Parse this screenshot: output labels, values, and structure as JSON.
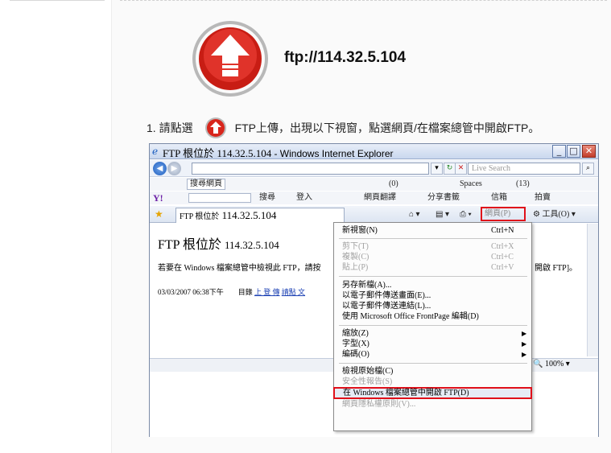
{
  "ftp_url": "ftp://114.32.5.104",
  "instruction": {
    "prefix": "1. 請點選",
    "suffix": "FTP上傳，出現以下視窗，點選網頁/在檔案總管中開啟FTP。"
  },
  "colors": {
    "accent_red": "#d8261c",
    "highlight_border": "#e0101a",
    "ie_blue": "#1f5fbf"
  },
  "icons": {
    "upload": "upload-arrow-icon",
    "ie": "ie-logo-icon",
    "home": "home-icon",
    "star": "favorites-star-icon"
  },
  "ie_window": {
    "title_ie": "FTP 根位於",
    "title_addr": "114.32.5.104",
    "title_app": "- Windows Internet Explorer",
    "search_placeholder": "Live Search",
    "toolbar1": {
      "search_label": "搜尋網頁",
      "inbox": "(0)",
      "spaces": "Spaces",
      "count": "(13)"
    },
    "toolbar2": {
      "search": "搜尋",
      "login": "登入",
      "translate": "網頁翻譯",
      "share": "分享書籤",
      "mail": "信箱",
      "stocks": "拍賣"
    },
    "tab_label_prefix": "FTP 根位於",
    "tab_label_addr": "114.32.5.104",
    "page_button": "網頁(P)",
    "tools_button": "工具(O)",
    "doc_heading_prefix": "FTP 根位於",
    "doc_heading_addr": "114.32.5.104",
    "doc_text": "若要在 Windows 檔案總管中檢視此 FTP，請按",
    "doc_text_right": "開啟 FTP]。",
    "doc_date": "03/03/2007 06:38下午",
    "doc_dir_label": "目錄",
    "doc_dir_link1": "上 登 傳",
    "doc_dir_link2": "請點 文",
    "zoom": "100%"
  },
  "menu": {
    "items": [
      {
        "label": "新視窗(N)",
        "shortcut": "Ctrl+N",
        "disabled": false
      },
      {
        "label": "剪下(T)",
        "shortcut": "Ctrl+X",
        "disabled": true
      },
      {
        "label": "複製(C)",
        "shortcut": "Ctrl+C",
        "disabled": true
      },
      {
        "label": "貼上(P)",
        "shortcut": "Ctrl+V",
        "disabled": true
      },
      {
        "label": "另存新檔(A)...",
        "shortcut": "",
        "disabled": false
      },
      {
        "label": "以電子郵件傳送畫面(E)...",
        "shortcut": "",
        "disabled": false
      },
      {
        "label": "以電子郵件傳送連結(L)...",
        "shortcut": "",
        "disabled": false
      },
      {
        "label": "使用 Microsoft Office FrontPage 編輯(D)",
        "shortcut": "",
        "disabled": false
      },
      {
        "label": "縮放(Z)",
        "shortcut": "",
        "disabled": false
      },
      {
        "label": "字型(X)",
        "shortcut": "",
        "disabled": false
      },
      {
        "label": "編碼(O)",
        "shortcut": "",
        "disabled": false
      },
      {
        "label": "檢視原始檔(C)",
        "shortcut": "",
        "disabled": false
      },
      {
        "label": "安全性報告(S)",
        "shortcut": "",
        "disabled": true
      },
      {
        "label": "在 Windows 檔案總管中開啟 FTP(D)",
        "shortcut": "",
        "disabled": false
      },
      {
        "label": "網頁隱私權原則(V)...",
        "shortcut": "",
        "disabled": true
      }
    ]
  }
}
